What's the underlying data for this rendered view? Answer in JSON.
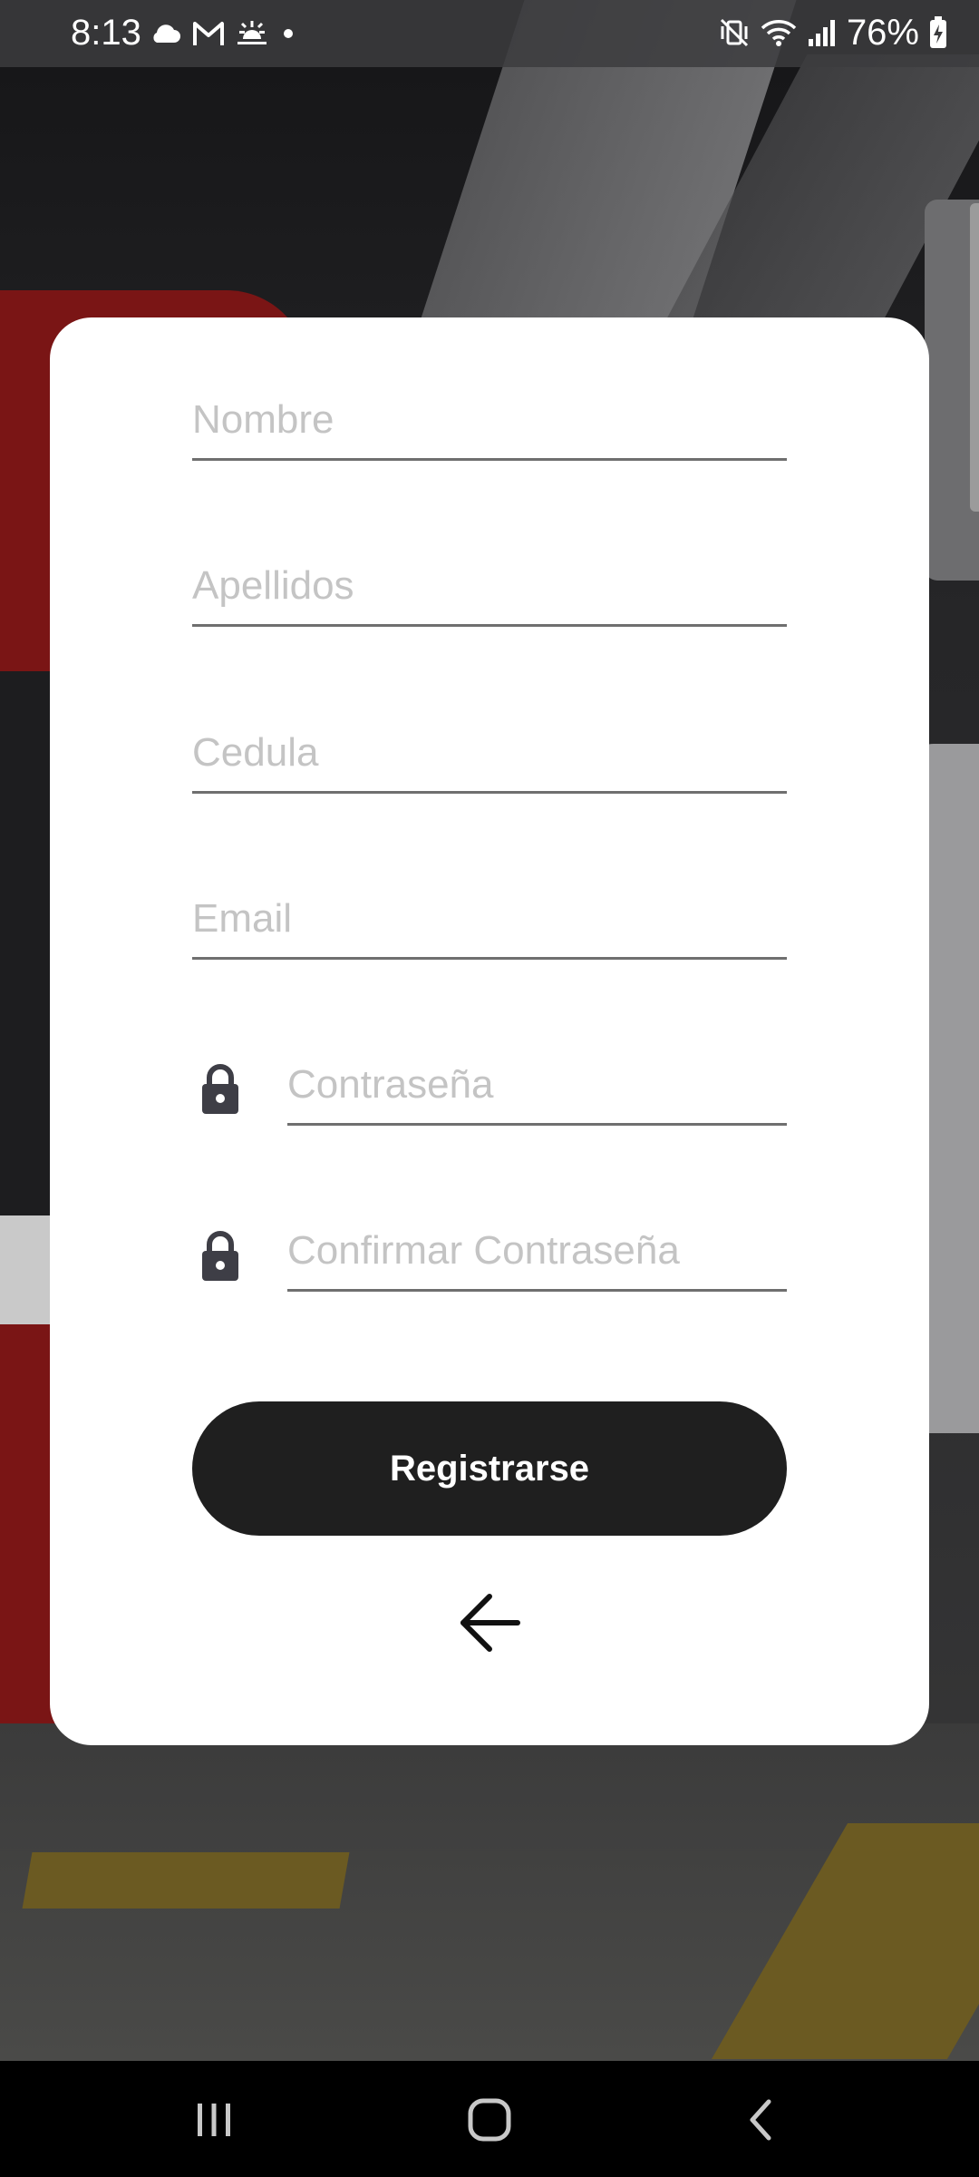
{
  "status_bar": {
    "time": "8:13",
    "left_icons": [
      "cloud-icon",
      "gmail-icon",
      "sunrise-icon",
      "dot-icon"
    ],
    "right_icons": [
      "mute-vibrate-icon",
      "wifi-icon",
      "signal-icon",
      "battery-charging-icon"
    ],
    "battery": "76%"
  },
  "form": {
    "nombre_placeholder": "Nombre",
    "apellidos_placeholder": "Apellidos",
    "cedula_placeholder": "Cedula",
    "email_placeholder": "Email",
    "password_placeholder": "Contraseña",
    "confirm_password_placeholder": "Confirmar Contraseña",
    "password_icon": "lock-icon",
    "register_label": "Registrarse",
    "back_icon": "arrow-left-icon"
  },
  "nav_bar": {
    "buttons": [
      "recent-apps-icon",
      "home-icon",
      "back-icon"
    ]
  },
  "colors": {
    "button_bg": "#1f1f1f",
    "card_bg": "#ffffff",
    "placeholder": "#c4c4c4",
    "underline": "#6f6f6f"
  }
}
